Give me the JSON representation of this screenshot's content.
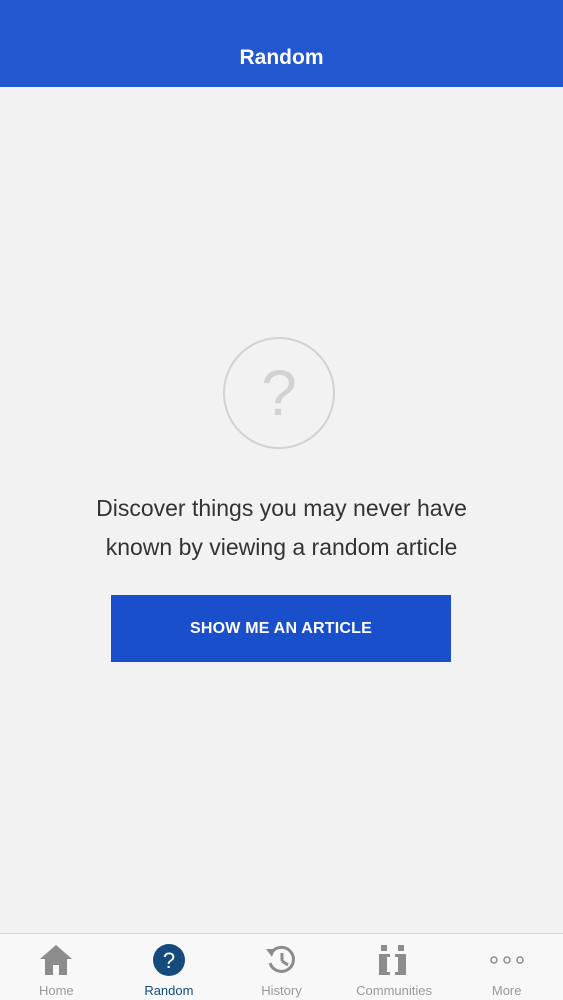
{
  "header": {
    "title": "Random"
  },
  "main": {
    "icon": "question-mark-circle-icon",
    "message_line1": "Discover things you may never have",
    "message_line2": "known by viewing a random article",
    "cta_label": "SHOW ME AN ARTICLE"
  },
  "tabbar": {
    "tabs": [
      {
        "label": "Home",
        "icon": "home-icon",
        "active": false
      },
      {
        "label": "Random",
        "icon": "question-circle-icon",
        "active": true
      },
      {
        "label": "History",
        "icon": "history-icon",
        "active": false
      },
      {
        "label": "Communities",
        "icon": "communities-icon",
        "active": false
      },
      {
        "label": "More",
        "icon": "more-icon",
        "active": false
      }
    ]
  },
  "colors": {
    "header_bg": "#2257cf",
    "button_bg": "#1a4fcc",
    "active_tab": "#144b7c",
    "inactive_tab": "#999999",
    "page_bg": "#f2f2f2"
  }
}
